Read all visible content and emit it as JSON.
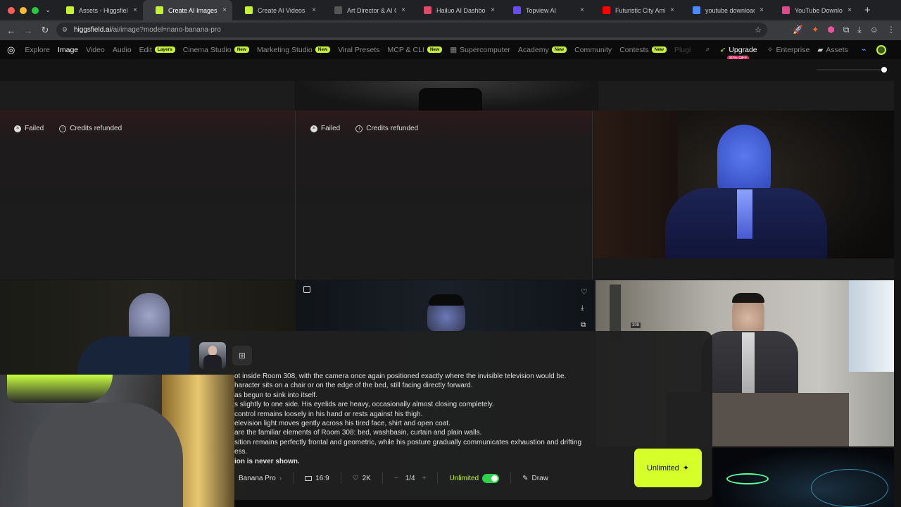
{
  "browser": {
    "tabs": [
      {
        "title": "Assets - Higgsfield",
        "color": "#c6f135"
      },
      {
        "title": "Create AI Images from",
        "color": "#c6f135"
      },
      {
        "title": "Create AI Videos from",
        "color": "#c6f135"
      },
      {
        "title": "Art Director & AI Cre",
        "color": "#555555"
      },
      {
        "title": "Hailuo AI Dashboard",
        "color": "#e04a6a"
      },
      {
        "title": "Topview AI",
        "color": "#6b4bff"
      },
      {
        "title": "Futuristic City Ambie",
        "color": "#ff0000"
      },
      {
        "title": "youtube download o",
        "color": "#4a8cff"
      },
      {
        "title": "YouTube Downloader",
        "color": "#e04a8a"
      }
    ],
    "url_domain": "higgsfield.ai",
    "url_path": "/ai/image?model=nano-banana-pro"
  },
  "nav": {
    "items": [
      {
        "label": "Explore",
        "badge": ""
      },
      {
        "label": "Image",
        "badge": ""
      },
      {
        "label": "Video",
        "badge": ""
      },
      {
        "label": "Audio",
        "badge": ""
      },
      {
        "label": "Edit",
        "badge": "Layers"
      },
      {
        "label": "Cinema Studio",
        "badge": "New"
      },
      {
        "label": "Marketing Studio",
        "badge": "New"
      },
      {
        "label": "Viral Presets",
        "badge": ""
      },
      {
        "label": "MCP & CLI",
        "badge": "New"
      },
      {
        "label": "Supercomputer",
        "badge": ""
      },
      {
        "label": "Academy",
        "badge": "New"
      },
      {
        "label": "Community",
        "badge": ""
      },
      {
        "label": "Contests",
        "badge": "New"
      },
      {
        "label": "Plugi",
        "badge": ""
      }
    ],
    "upgrade": "Upgrade",
    "upgrade_offer": "30% OFF",
    "enterprise": "Enterprise",
    "assets": "Assets",
    "accent": "#c6f135"
  },
  "gallery": {
    "failed_label": "Failed",
    "refund_label": "Credits refunded",
    "room_sign": "308"
  },
  "composer": {
    "prompt_lines": [
      "ot inside Room 308, with the camera once again positioned exactly where the invisible television would be.",
      "haracter sits on a chair or on the edge of the bed, still facing directly forward.",
      "as begun to sink into itself.",
      "s slightly to one side. His eyelids are heavy, occasionally almost closing completely.",
      "control remains loosely in his hand or rests against his thigh.",
      "elevision light moves gently across his tired face, shirt and open coat.",
      "are the familiar elements of Room 308: bed, washbasin, curtain and plain walls.",
      "sition remains perfectly frontal and geometric, while his posture gradually communicates exhaustion and drifting",
      "ess.",
      "ion is never shown."
    ],
    "model": "Banana Pro",
    "aspect": "16:9",
    "resolution": "2K",
    "count": "1/4",
    "unlimited_label": "Unlimited",
    "draw_label": "Draw",
    "generate_label": "Unlimited",
    "generate_color": "#d6ff2a"
  }
}
